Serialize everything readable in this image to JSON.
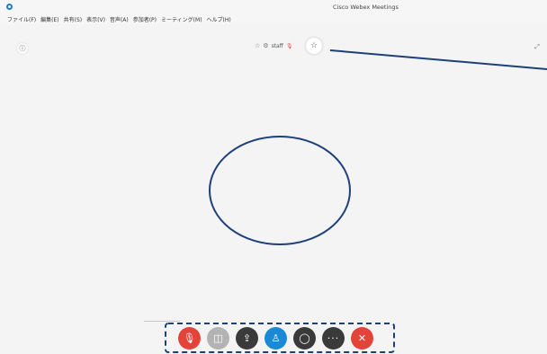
{
  "window": {
    "title": "Cisco Webex Meetings",
    "logo_icon": "webex-logo-icon"
  },
  "menu": {
    "items": [
      "ファイル(F)",
      "編集(E)",
      "共有(S)",
      "表示(V)",
      "音声(A)",
      "参加者(P)",
      "ミーティング(M)",
      "ヘルプ(H)"
    ]
  },
  "stage": {
    "info_icon": "info-icon",
    "presenter_name": "staff",
    "presenter_icons": [
      "pin-icon",
      "settings-icon",
      "mic-muted-icon"
    ],
    "pin_icon": "pin-icon",
    "fullscreen_icon": "fullscreen-icon",
    "info_glyph": "ⓘ",
    "pin_glyph": "☆",
    "settings_glyph": "⚙",
    "mic_glyph": "🎙",
    "fullscreen_glyph": "⤢"
  },
  "toolbar": {
    "buttons": [
      {
        "name": "mute",
        "icon": "mic-muted-icon",
        "glyph": "🎙",
        "color": "#e4433a"
      },
      {
        "name": "video",
        "icon": "video-off-icon",
        "glyph": "◫",
        "color": "#b3b3b3"
      },
      {
        "name": "share",
        "icon": "share-icon",
        "glyph": "⇪",
        "color": "#3a3a3a"
      },
      {
        "name": "participants",
        "icon": "participants-icon",
        "glyph": "♙",
        "color": "#1a8ad6"
      },
      {
        "name": "chat",
        "icon": "chat-icon",
        "glyph": "◯",
        "color": "#3a3a3a"
      },
      {
        "name": "more",
        "icon": "more-icon",
        "glyph": "···",
        "color": "#3a3a3a"
      },
      {
        "name": "end",
        "icon": "close-icon",
        "glyph": "✕",
        "color": "#e4433a"
      }
    ]
  },
  "annotations": {
    "stroke_color": "#1f3f7a"
  }
}
